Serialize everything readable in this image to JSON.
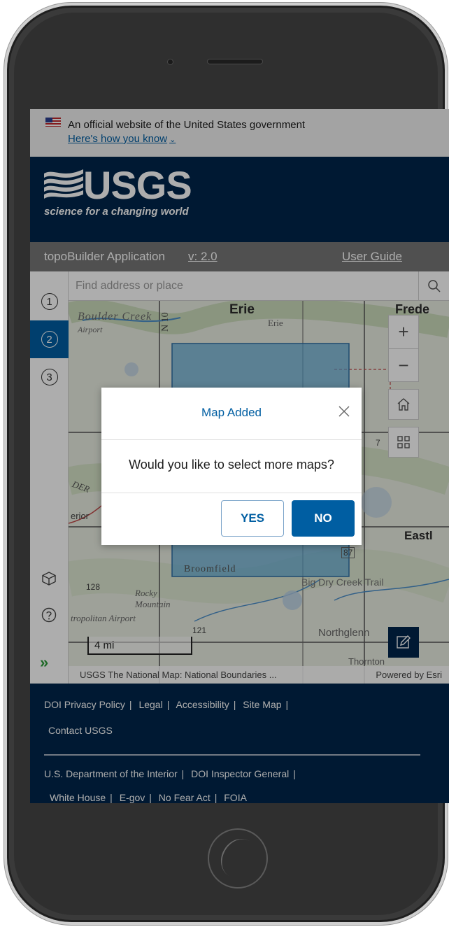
{
  "gov_banner": {
    "text": "An official website of the United States government",
    "link": "Here's how you know"
  },
  "header": {
    "logo_text": "USGS",
    "tagline": "science for a changing world"
  },
  "app_bar": {
    "title": "topoBuilder Application",
    "version": "v: 2.0",
    "user_guide": "User Guide"
  },
  "rail": {
    "steps": [
      "1",
      "2",
      "3"
    ],
    "active_step": "2"
  },
  "search": {
    "placeholder": "Find address or place"
  },
  "map": {
    "labels": {
      "erie_large": "Erie",
      "erie_small": "Erie",
      "boulder_creek": "Boulder Creek",
      "airport": "Airport",
      "frede": "Frede",
      "eastl": "Eastl",
      "broomfield": "Broomfield",
      "big_dry_creek": "Big Dry Creek Trail",
      "rocky_mountain": "Rocky Mountain",
      "metro_airport": "tropolitan Airport",
      "northglenn": "Northglenn",
      "thornton": "Thornton",
      "route_128": "128",
      "route_121": "121",
      "route_87": "87",
      "route_7": "7",
      "interior": "erior",
      "n_103": "N 10",
      "der": "DER"
    },
    "scale": "4 mi",
    "attribution": "USGS The National Map: National Boundaries ...",
    "powered_by": "Powered by Esri",
    "selection_color": "#5ba8d6"
  },
  "modal": {
    "title": "Map Added",
    "body": "Would you like to select more maps?",
    "yes_label": "YES",
    "no_label": "NO"
  },
  "footer": {
    "row1": [
      "DOI Privacy Policy",
      "Legal",
      "Accessibility",
      "Site Map"
    ],
    "row2": [
      "Contact USGS"
    ],
    "row3": [
      "U.S. Department of the Interior",
      "DOI Inspector General"
    ],
    "row4": [
      "White House",
      "E-gov",
      "No Fear Act",
      "FOIA"
    ]
  },
  "colors": {
    "usgs_navy": "#00264c",
    "primary_blue": "#005ea2",
    "app_bar_gray": "#767676"
  }
}
